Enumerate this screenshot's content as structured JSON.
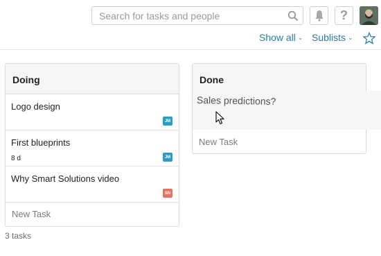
{
  "header": {
    "search_placeholder": "Search for tasks and people",
    "help_label": "?",
    "show_all_label": "Show all",
    "sublists_label": "Sublists"
  },
  "columns": [
    {
      "title": "Doing",
      "tasks": [
        {
          "title": "Logo design",
          "meta": "",
          "assignee": "JM",
          "assignee_color": "#2a9cc6"
        },
        {
          "title": "First blueprints",
          "meta": "8 d",
          "assignee": "JM",
          "assignee_color": "#2a9cc6"
        },
        {
          "title": "Why Smart Solutions video",
          "meta": "",
          "assignee": "SN",
          "assignee_color": "#e27362"
        }
      ],
      "new_task_label": "New Task",
      "count_label": "3 tasks"
    },
    {
      "title": "Done",
      "tasks": [],
      "new_task_label": "New Task"
    }
  ],
  "dragging_card": {
    "title": "Sales predictions?"
  },
  "colors": {
    "accent": "#2b7aa8",
    "border": "#dcdcdc",
    "header_bg": "#f5f5f5"
  },
  "icons": {
    "search": "search-icon",
    "bell": "bell-icon",
    "help": "question-icon",
    "avatar": "user-avatar",
    "star": "star-icon",
    "cursor": "mouse-pointer-icon"
  }
}
